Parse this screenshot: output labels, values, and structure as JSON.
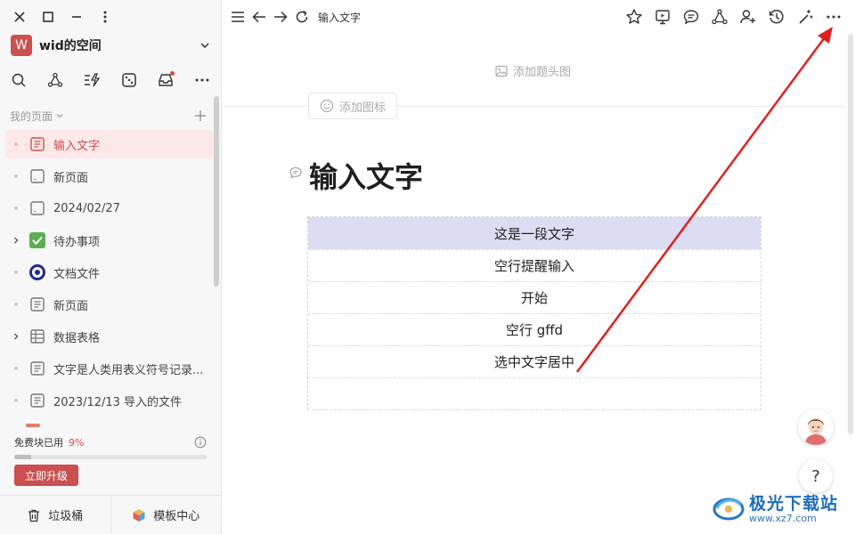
{
  "sidebar": {
    "space_initial": "W",
    "space_name": "wid的空间",
    "section_label": "我的页面",
    "pages": [
      {
        "label": "输入文字",
        "icon": "doc-icon",
        "active": true
      },
      {
        "label": "新页面",
        "icon": "blank-page-icon"
      },
      {
        "label": "2024/02/27",
        "icon": "blank-page-icon"
      },
      {
        "label": "待办事项",
        "icon": "checkbox-icon"
      },
      {
        "label": "文档文件",
        "icon": "target-icon"
      },
      {
        "label": "新页面",
        "icon": "doc-icon"
      },
      {
        "label": "数据表格",
        "icon": "table-icon"
      },
      {
        "label": "文字是人类用表义符号记录...",
        "icon": "doc-icon"
      },
      {
        "label": "2023/12/13 导入的文件",
        "icon": "doc-icon"
      }
    ],
    "usage_label": "免费块已用",
    "usage_percent": "9%",
    "usage_fraction": 0.09,
    "upgrade_label": "立即升级",
    "trash_label": "垃圾桶",
    "template_label": "模板中心"
  },
  "topbar": {
    "title": "输入文字",
    "actions": [
      "star-icon",
      "present-icon",
      "comment-icon",
      "share-graph-icon",
      "add-user-icon",
      "history-icon",
      "magic-icon",
      "more-icon"
    ]
  },
  "editor": {
    "add_cover_label": "添加题头图",
    "add_icon_label": "添加图标",
    "title": "输入文字",
    "rows": [
      "这是一段文字",
      "空行提醒输入",
      "开始",
      "空行 gffd",
      "选中文字居中",
      ""
    ]
  },
  "help_label": "?",
  "watermark": {
    "name": "极光下载站",
    "url": "www.xz7.com"
  },
  "colors": {
    "accent": "#c9504f",
    "selected_row": "#dcdcf2",
    "arrow": "#e02020"
  }
}
